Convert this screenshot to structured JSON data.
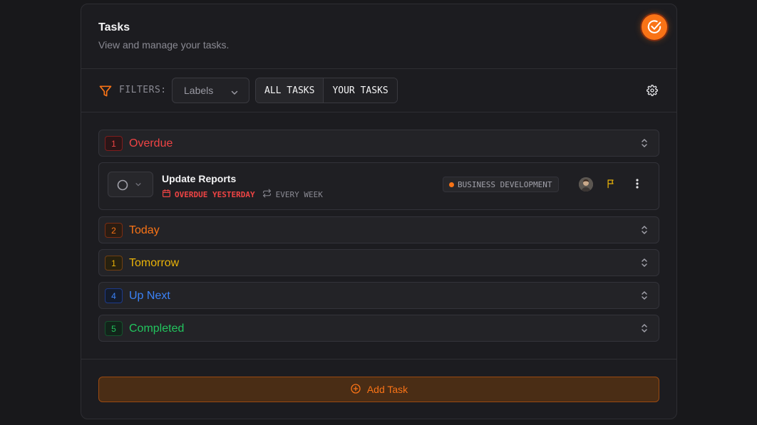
{
  "header": {
    "title": "Tasks",
    "subtitle": "View and manage your tasks.",
    "brand_icon": "check-circle-icon",
    "accent": "#f97316"
  },
  "filters": {
    "label": "FILTERS:",
    "labels_select": {
      "value": "Labels"
    },
    "scope_tabs": [
      {
        "label": "ALL TASKS",
        "active": true
      },
      {
        "label": "YOUR TASKS",
        "active": false
      }
    ]
  },
  "groups": [
    {
      "name": "Overdue",
      "count": "1",
      "color": "#ef4444",
      "expanded": true
    },
    {
      "name": "Today",
      "count": "2",
      "color": "#f97316",
      "expanded": false
    },
    {
      "name": "Tomorrow",
      "count": "1",
      "color": "#eab308",
      "expanded": false
    },
    {
      "name": "Up Next",
      "count": "4",
      "color": "#3b82f6",
      "expanded": false
    },
    {
      "name": "Completed",
      "count": "5",
      "color": "#22c55e",
      "expanded": false
    }
  ],
  "tasks": [
    {
      "title": "Update Reports",
      "due": "OVERDUE YESTERDAY",
      "repeat": "EVERY WEEK",
      "label": "BUSINESS DEVELOPMENT",
      "label_color": "#f97316",
      "priority_color": "#eab308"
    }
  ],
  "footer": {
    "add_label": "Add Task"
  }
}
